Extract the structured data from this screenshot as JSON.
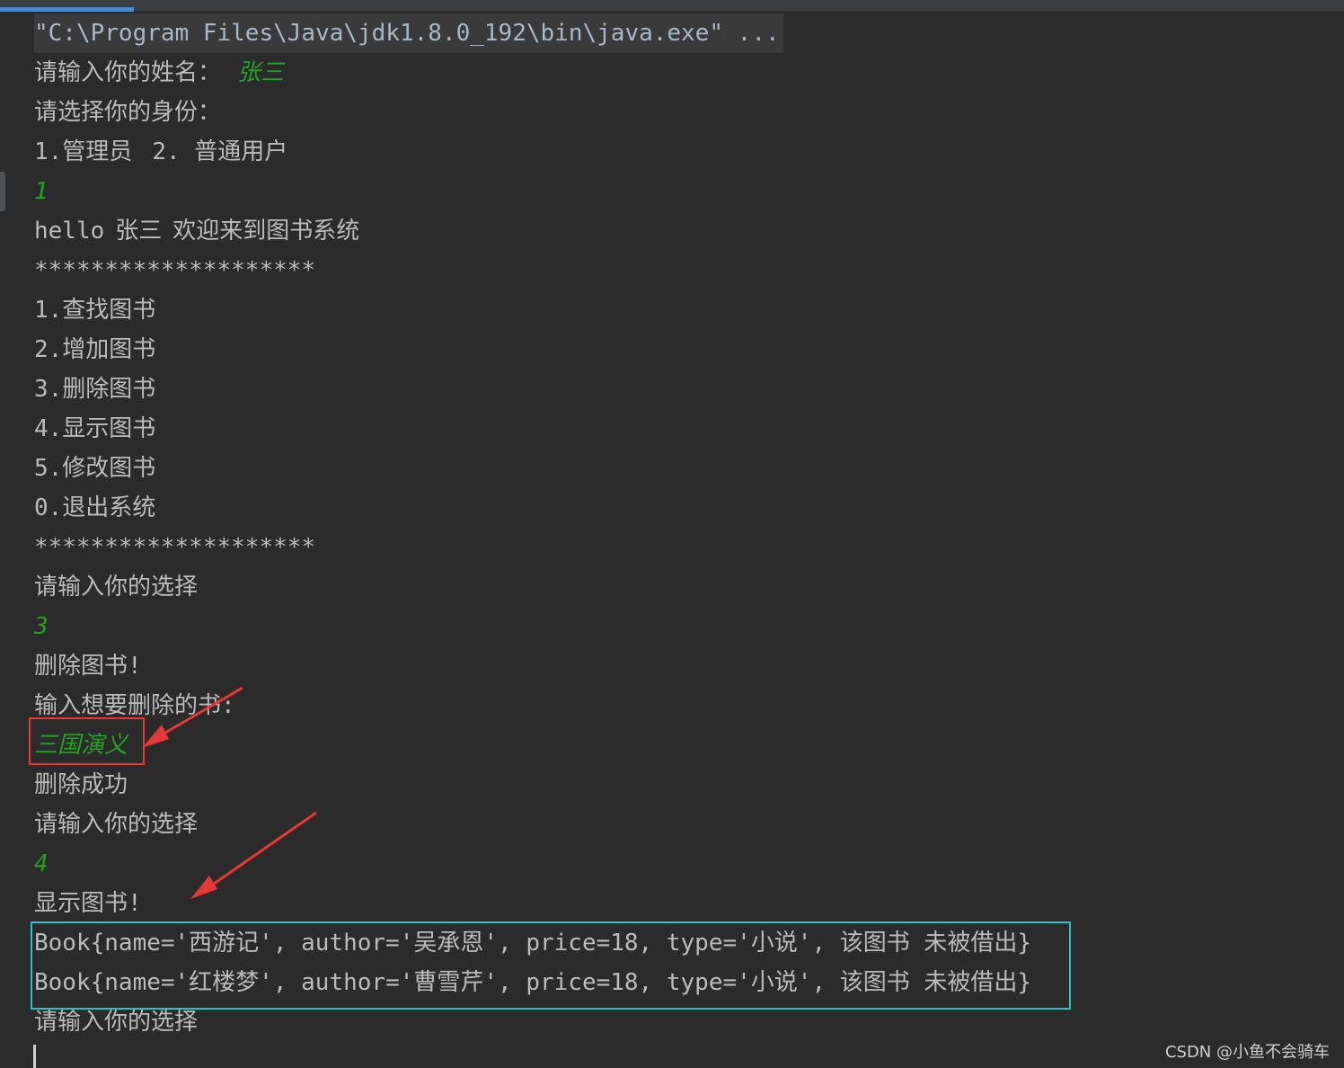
{
  "command_line": "\"C:\\Program Files\\Java\\jdk1.8.0_192\\bin\\java.exe\" ...",
  "name_prompt": "请输入你的姓名：",
  "name_input": "张三",
  "role_prompt": "请选择你的身份：",
  "role_option_1": "1.管理员",
  "role_option_2": "2. 普通用户",
  "role_input": "1",
  "greeting_hello": "hello",
  "greeting_name": "张三",
  "greeting_text": "欢迎来到图书系统",
  "stars": "********************",
  "menu": [
    "1.查找图书",
    "2.增加图书",
    "3.删除图书",
    "4.显示图书",
    "5.修改图书",
    "0.退出系统"
  ],
  "choice_prompt": "请输入你的选择",
  "choice_input_1": "3",
  "delete_header": "删除图书!",
  "delete_prompt": "输入想要删除的书:",
  "delete_input": "三国演义",
  "delete_result": "删除成功",
  "choice_input_2": "4",
  "show_header": "显示图书!",
  "books": [
    "Book{name='西游记', author='吴承恩', price=18, type='小说', 该图书 未被借出}",
    "Book{name='红楼梦', author='曹雪芹', price=18, type='小说', 该图书 未被借出}"
  ],
  "watermark": "CSDN @小鱼不会骑车",
  "colors": {
    "background": "#2b2b2b",
    "text": "#bbbbbb",
    "user_input": "#23a123",
    "red_highlight": "#e53935",
    "cyan_highlight": "#25c4c8"
  }
}
